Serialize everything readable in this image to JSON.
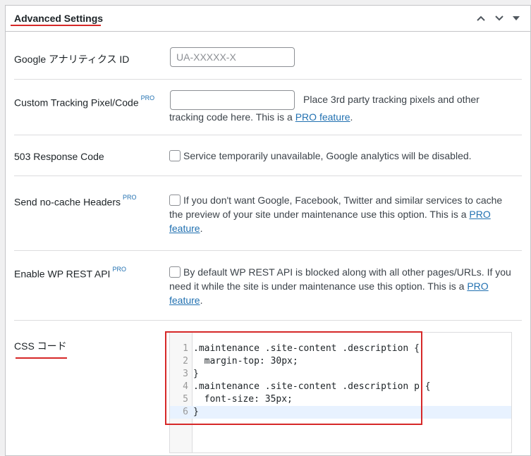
{
  "panel": {
    "title": "Advanced Settings"
  },
  "header_icons": [
    "chevron-up-icon",
    "chevron-down-icon",
    "triangle-down-icon"
  ],
  "rows": {
    "ga": {
      "label": "Google アナリティクス ID",
      "placeholder": "UA-XXXXX-X"
    },
    "pixel": {
      "label": "Custom Tracking Pixel/Code",
      "badge": "PRO",
      "desc_before": "Place 3rd party tracking pixels and other",
      "desc_line2": "tracking code here. This is a ",
      "link": "PRO feature",
      "desc_end": "."
    },
    "r503": {
      "label": "503 Response Code",
      "desc": "Service temporarily unavailable, Google analytics will be disabled."
    },
    "nocache": {
      "label": "Send no-cache Headers",
      "badge": "PRO",
      "line1": "If you don't want Google, Facebook, Twitter and similar services to cache",
      "line2": "the preview of your site under maintenance use this option. This is a ",
      "link1": "PRO",
      "link2": "feature",
      "end": "."
    },
    "rest": {
      "label": "Enable WP REST API",
      "badge": "PRO",
      "line1": "By default WP REST API is blocked along with all other pages/URLs. If you",
      "line2": "need it while the site is under maintenance use this option. This is a ",
      "link1": "PRO",
      "link2": "feature",
      "end": "."
    },
    "css": {
      "label": "CSS コード"
    }
  },
  "code": {
    "lines": [
      {
        "n": "1",
        "t": ".maintenance .site-content .description {"
      },
      {
        "n": "2",
        "t": "  margin-top: 30px;"
      },
      {
        "n": "3",
        "t": "}"
      },
      {
        "n": "4",
        "t": ".maintenance .site-content .description p {"
      },
      {
        "n": "5",
        "t": "  font-size: 35px;"
      },
      {
        "n": "6",
        "t": "}"
      }
    ]
  },
  "colors": {
    "accent_red": "#d62828",
    "link": "#2271b1"
  }
}
